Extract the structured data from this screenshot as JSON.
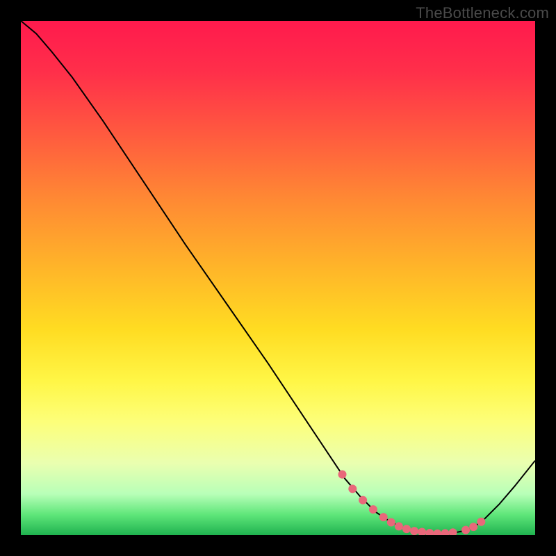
{
  "watermark": "TheBottleneck.com",
  "chart_data": {
    "type": "line",
    "title": "",
    "xlabel": "",
    "ylabel": "",
    "xlim": [
      0,
      100
    ],
    "ylim": [
      0,
      100
    ],
    "background_gradient": {
      "type": "vertical",
      "stops": [
        {
          "offset": 0.0,
          "color": "#ff1a4d"
        },
        {
          "offset": 0.1,
          "color": "#ff2f4a"
        },
        {
          "offset": 0.22,
          "color": "#ff5a3f"
        },
        {
          "offset": 0.35,
          "color": "#ff8a33"
        },
        {
          "offset": 0.48,
          "color": "#ffb529"
        },
        {
          "offset": 0.6,
          "color": "#ffdc22"
        },
        {
          "offset": 0.7,
          "color": "#fff646"
        },
        {
          "offset": 0.78,
          "color": "#fdff7a"
        },
        {
          "offset": 0.86,
          "color": "#eaffb0"
        },
        {
          "offset": 0.92,
          "color": "#b8ffb8"
        },
        {
          "offset": 0.96,
          "color": "#5fe67a"
        },
        {
          "offset": 1.0,
          "color": "#1fb24f"
        }
      ]
    },
    "series": [
      {
        "name": "curve",
        "color": "#000000",
        "stroke_width": 2,
        "x": [
          0.0,
          3.0,
          6.0,
          10.0,
          16.0,
          24.0,
          32.0,
          40.0,
          48.0,
          56.0,
          60.0,
          63.0,
          66.0,
          69.0,
          72.0,
          75.0,
          78.0,
          81.0,
          84.0,
          86.0,
          88.0,
          90.0,
          93.0,
          96.0,
          100.0
        ],
        "y": [
          100.0,
          97.5,
          94.0,
          89.0,
          80.5,
          68.5,
          56.5,
          45.0,
          33.5,
          21.5,
          15.5,
          11.0,
          7.5,
          4.5,
          2.5,
          1.2,
          0.6,
          0.3,
          0.4,
          0.8,
          1.5,
          3.0,
          6.0,
          9.5,
          14.5
        ]
      }
    ],
    "markers": {
      "name": "highlight-dots",
      "color": "#e9687a",
      "radius": 6,
      "x": [
        62.5,
        64.5,
        66.5,
        68.5,
        70.5,
        72.0,
        73.5,
        75.0,
        76.5,
        78.0,
        79.5,
        81.0,
        82.5,
        84.0,
        86.5,
        88.0,
        89.5
      ],
      "y": [
        11.8,
        9.0,
        6.8,
        5.0,
        3.5,
        2.5,
        1.7,
        1.2,
        0.8,
        0.6,
        0.4,
        0.3,
        0.35,
        0.5,
        1.0,
        1.6,
        2.6
      ]
    }
  }
}
